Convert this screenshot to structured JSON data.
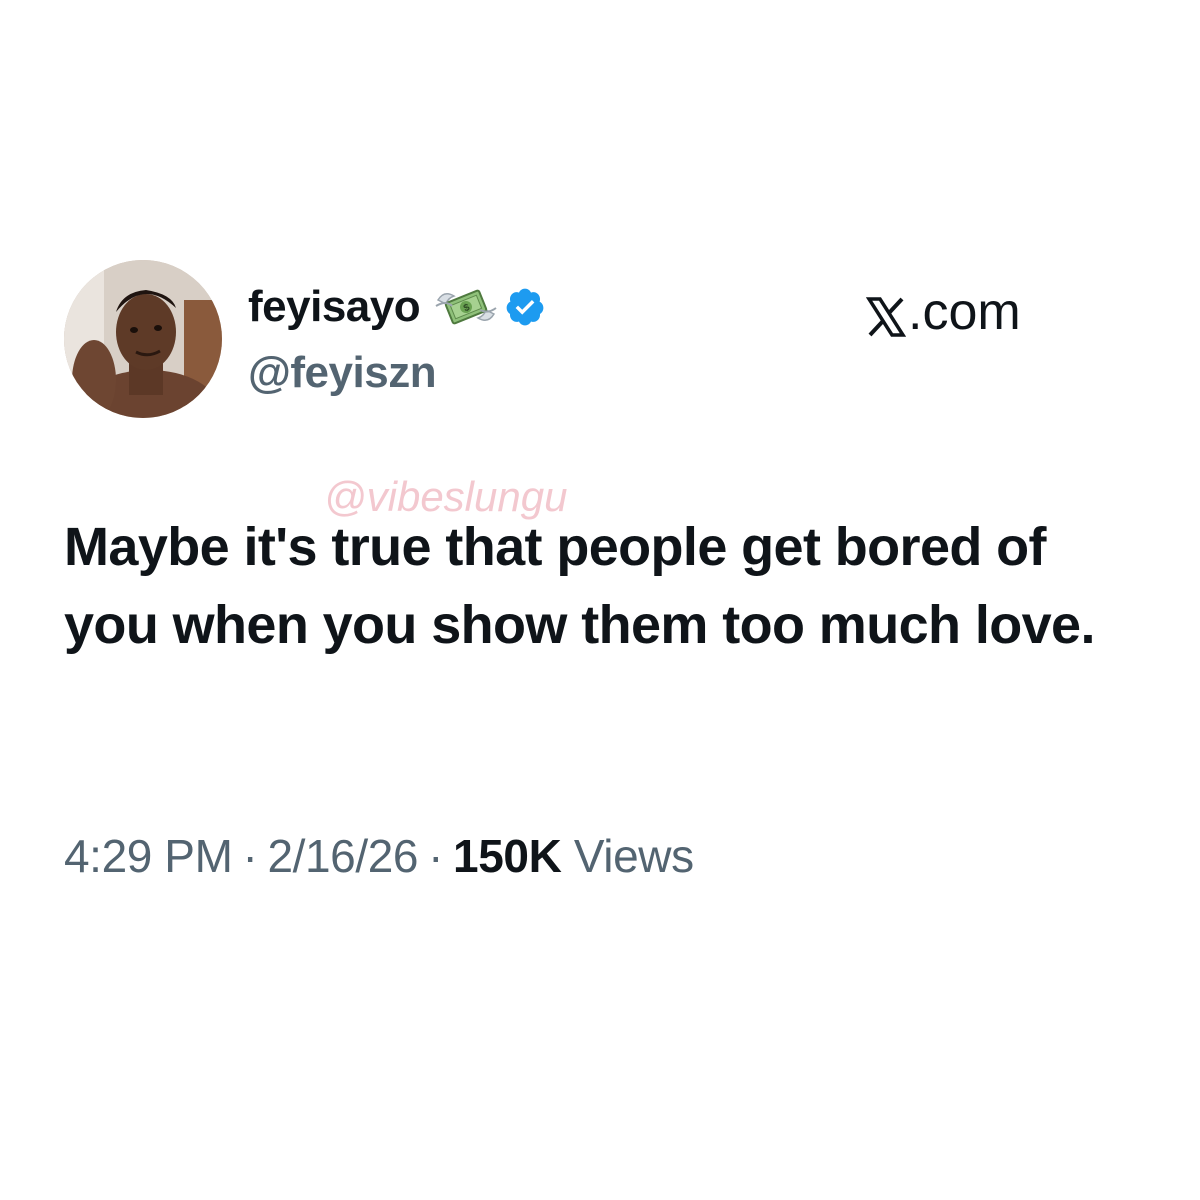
{
  "author": {
    "display_name": "feyisayo",
    "handle": "@feyiszn",
    "avatar_icon": "avatar-photo",
    "name_emoji_icon": "money-with-wings-icon",
    "verified_icon": "verified-badge-icon",
    "verified_color": "#1d9bf0"
  },
  "site": {
    "label": ".com",
    "logo_icon": "x-logo-icon"
  },
  "watermark": "@vibeslungu",
  "tweet": {
    "text": "Maybe it's true that people get bored of you when you show them too much love."
  },
  "meta": {
    "time": "4:29 PM",
    "date": "2/16/26",
    "views_count": "150K",
    "views_label": "Views",
    "separator": "·"
  },
  "colors": {
    "text_primary": "#0f1419",
    "text_secondary": "#536471",
    "watermark": "#f3c8cf"
  }
}
